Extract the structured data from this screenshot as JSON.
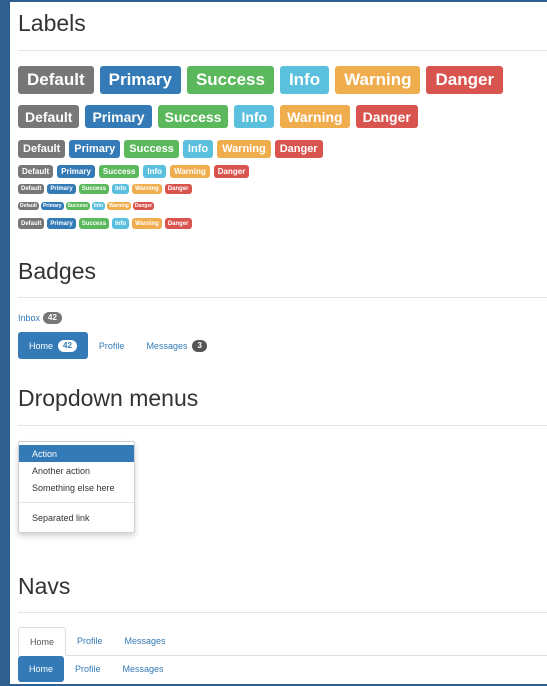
{
  "sections": {
    "labels": "Labels",
    "badges": "Badges",
    "dropdowns": "Dropdown menus",
    "navs": "Navs"
  },
  "label_names": [
    "Default",
    "Primary",
    "Success",
    "Info",
    "Warning",
    "Danger"
  ],
  "colors": {
    "default": "#777777",
    "primary": "#337ab7",
    "success": "#5cb85c",
    "info": "#5bc0de",
    "warning": "#f0ad4e",
    "danger": "#d9534f"
  },
  "badges": {
    "inbox_link": "Inbox",
    "inbox_count": "42",
    "pills": [
      {
        "label": "Home",
        "count": "42"
      },
      {
        "label": "Profile"
      },
      {
        "label": "Messages",
        "count": "3"
      }
    ]
  },
  "dropdown": {
    "items": [
      "Action",
      "Another action",
      "Something else here"
    ],
    "separated": "Separated link"
  },
  "navs": {
    "tabs": [
      "Home",
      "Profile",
      "Messages"
    ],
    "pills": [
      "Home",
      "Profile",
      "Messages"
    ]
  }
}
